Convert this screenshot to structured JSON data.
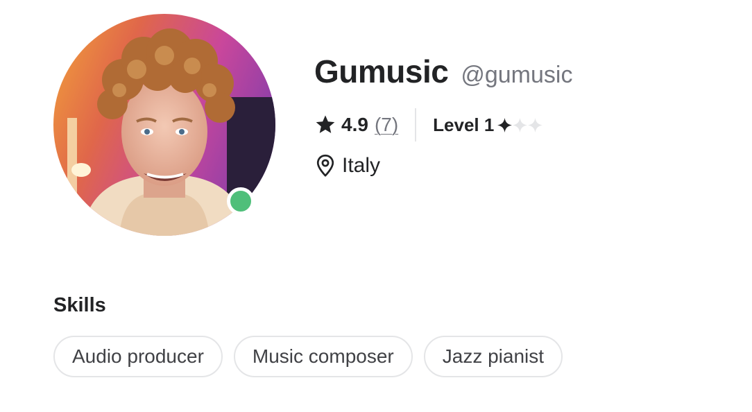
{
  "profile": {
    "display_name": "Gumusic",
    "username": "@gumusic",
    "online": true,
    "avatar": "profile-photo",
    "rating": "4.9",
    "review_count": "(7)",
    "level": "Level 1",
    "level_diamonds_filled": 1,
    "level_diamonds_total": 3,
    "location": "Italy"
  },
  "skills": {
    "heading": "Skills",
    "items": [
      "Audio producer",
      "Music composer",
      "Jazz pianist"
    ]
  },
  "icons": {
    "rating": "star-icon",
    "location": "location-pin-icon",
    "level": "diamond-icon"
  },
  "colors": {
    "online": "#4fbf7a",
    "text_primary": "#222325",
    "text_muted": "#74767e",
    "border": "#e4e5e7"
  }
}
